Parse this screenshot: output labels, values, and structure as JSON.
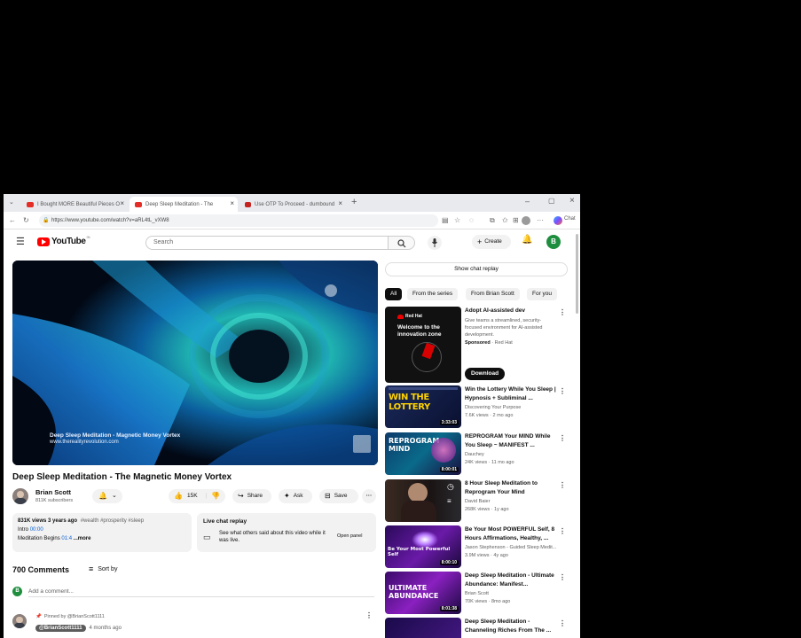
{
  "browser": {
    "tabs": [
      {
        "title": "I Bought MORE Beautiful Pieces O",
        "color": "#e52d27"
      },
      {
        "title": "Deep Sleep Meditation - The",
        "color": "#e52d27"
      },
      {
        "title": "Use OTP To Proceed - dumbound",
        "color": "#c5221f"
      }
    ],
    "new_tab": "+",
    "url": "https://www.youtube.com/watch?v=aRL4tL_vXW8",
    "copilot_label": "Chat"
  },
  "youtube": {
    "logo_text": "YouTube",
    "logo_region": "IN",
    "search_placeholder": "Search",
    "create_label": "Create",
    "avatar_letter": "B"
  },
  "video": {
    "watermark_line1": "Deep Sleep Meditation - Magnetic Money Vortex",
    "watermark_line2": "www.therealityrevolution.com",
    "title": "Deep Sleep Meditation - The Magnetic Money Vortex"
  },
  "channel": {
    "name": "Brian Scott",
    "subscribers": "811K subscribers",
    "likes": "15K",
    "share_label": "Share",
    "ask_label": "Ask",
    "save_label": "Save"
  },
  "description": {
    "stats": "831K views  3 years ago",
    "hashtags": "#wealth #prosperity #sleep",
    "line2_label": "Intro",
    "line2_time": "00:00",
    "line3_label": "Meditation Begins",
    "line3_time": "01:4",
    "more_label": "...more"
  },
  "live_chat": {
    "title": "Live chat replay",
    "text": "See what others said about this video while it was live.",
    "open_label": "Open panel"
  },
  "comments": {
    "count_label": "700 Comments",
    "sort_label": "Sort by",
    "add_placeholder": "Add a comment...",
    "user_initial": "B",
    "pinned_label": "Pinned by @BrianScott1111",
    "author": "@BrianScott1111",
    "time": "4 months ago"
  },
  "sidebar": {
    "chat_replay_button": "Show chat replay",
    "chips": [
      "All",
      "From the series",
      "From Brian Scott",
      "For you"
    ],
    "ad": {
      "title": "Adopt AI-assisted dev",
      "text": "Give teams a streamlined, security-focused environment for AI-assisted development.",
      "sponsor_label": "Sponsored",
      "sponsor": "Red Hat",
      "cta": "Download",
      "thumb_brand": "Red Hat",
      "thumb_text": "Welcome to the innovation zone"
    },
    "recs": [
      {
        "title": "Win the Lottery While You Sleep | Hypnosis + Subliminal ...",
        "channel": "Discovering Your Purpose",
        "meta": "7.6K views · 2 mo ago",
        "duration": "3:33:03",
        "thumb_text": "WIN THE LOTTERY"
      },
      {
        "title": "REPROGRAM Your MIND While You Sleep ~ MANIFEST ...",
        "channel": "Dauchey",
        "meta": "24K views · 11 mo ago",
        "duration": "8:00:01",
        "thumb_text": "REPROGRAM MIND"
      },
      {
        "title": "8 Hour Sleep Meditation to Reprogram Your Mind",
        "channel": "David Baier",
        "meta": "268K views · 1y ago",
        "duration": "",
        "thumb_text": ""
      },
      {
        "title": "Be Your Most POWERFUL Self, 8 Hours Affirmations, Healthy, ...",
        "channel": "Jason Stephenson - Guided Sleep Medit...",
        "meta": "3.9M views · 4y ago",
        "duration": "8:00:10",
        "thumb_text": "Be Your Most Powerful Self"
      },
      {
        "title": "Deep Sleep Meditation - Ultimate Abundance: Manifest...",
        "channel": "Brian Scott",
        "meta": "70K views · 8mo ago",
        "duration": "8:01:38",
        "thumb_text": "ULTIMATE ABUNDANCE"
      },
      {
        "title": "Deep Sleep Meditation - Channeling Riches From The ...",
        "channel": "",
        "meta": "",
        "duration": "",
        "thumb_text": ""
      }
    ]
  }
}
